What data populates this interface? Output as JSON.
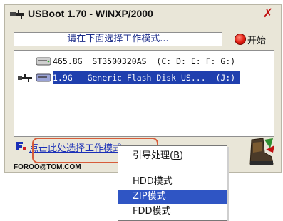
{
  "window": {
    "title": "USBoot 1.70 - WINXP/2000",
    "close_symbol": "✗"
  },
  "prompt": {
    "text": "请在下面选择工作模式..."
  },
  "start_button": {
    "label": "开始"
  },
  "disks": [
    {
      "text": "465.8G  ST3500320AS  (C: D: E: F: G:)",
      "selected": false
    },
    {
      "text": "1.9G   Generic Flash Disk US...  (J:)",
      "selected": true
    }
  ],
  "footer": {
    "link_text": "点击此处选择工作模式",
    "email": "FOROO@TOM.COM"
  },
  "menu": {
    "items": [
      {
        "label": "引导处理",
        "hotkey": "B",
        "selected": false
      },
      {
        "label": "HDD模式",
        "selected": false
      },
      {
        "label": "ZIP模式",
        "selected": true
      },
      {
        "label": "FDD模式",
        "selected": false
      }
    ]
  },
  "colors": {
    "accent": "#1f3fae",
    "link": "#1a2fb7",
    "highlight": "#d75c3a",
    "start_red": "#e11b10"
  }
}
